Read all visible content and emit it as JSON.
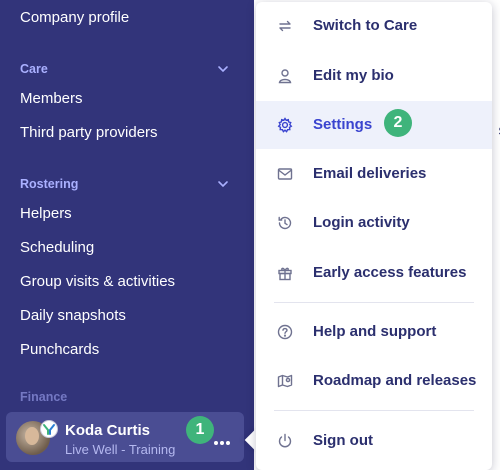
{
  "sidebar": {
    "top_item": "Company profile",
    "sections": [
      {
        "title": "Care",
        "items": [
          "Members",
          "Third party providers"
        ]
      },
      {
        "title": "Rostering",
        "items": [
          "Helpers",
          "Scheduling",
          "Group visits & activities",
          "Daily snapshots",
          "Punchcards"
        ]
      },
      {
        "title": "Finance"
      }
    ]
  },
  "user": {
    "name": "Koda Curtis",
    "org": "Live Well - Training"
  },
  "steps": {
    "one": "1",
    "two": "2"
  },
  "menu": {
    "items": [
      {
        "label": "Switch to Care",
        "icon": "switch-arrows-icon"
      },
      {
        "label": "Edit my bio",
        "icon": "person-icon"
      },
      {
        "label": "Settings",
        "icon": "gear-icon",
        "active": true
      },
      {
        "label": "Email deliveries",
        "icon": "envelope-icon"
      },
      {
        "label": "Login activity",
        "icon": "history-clock-icon"
      },
      {
        "label": "Early access features",
        "icon": "gift-icon"
      },
      {
        "label": "Help and support",
        "icon": "help-circle-icon"
      },
      {
        "label": "Roadmap and releases",
        "icon": "map-pin-icon"
      },
      {
        "label": "Sign out",
        "icon": "power-icon"
      }
    ]
  },
  "colors": {
    "sidebar_bg": "#32347a",
    "section_title": "#aab0ff",
    "step_badge": "#3fb47b",
    "active_item_bg": "#eef1fb",
    "active_item_text": "#3a44cf"
  }
}
